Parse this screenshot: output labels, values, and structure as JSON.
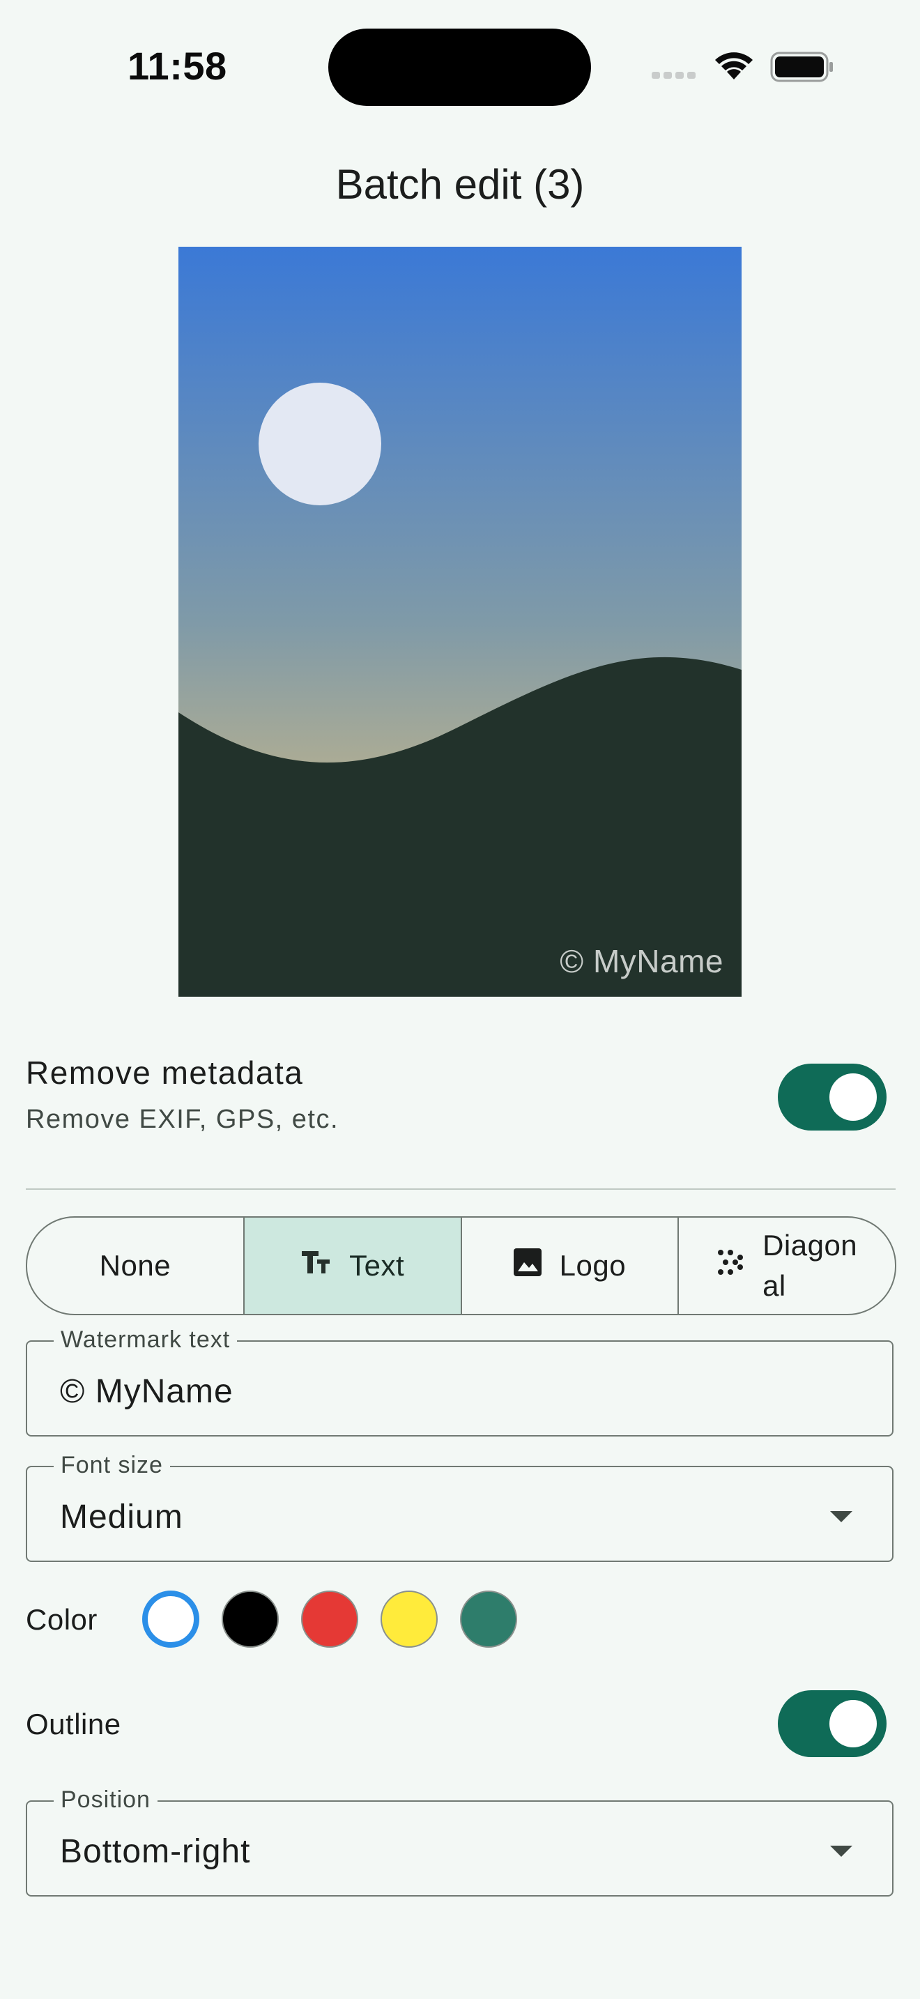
{
  "status": {
    "time": "11:58"
  },
  "header": {
    "title": "Batch edit (3)"
  },
  "preview": {
    "watermark_overlay": "© MyName"
  },
  "metadata": {
    "title": "Remove metadata",
    "subtitle": "Remove EXIF, GPS, etc.",
    "enabled": true
  },
  "watermark_type": {
    "options": [
      {
        "label": "None",
        "icon": ""
      },
      {
        "label": "Text",
        "icon": "text-fields-icon"
      },
      {
        "label": "Logo",
        "icon": "image-icon"
      },
      {
        "label": "Diagon\nal",
        "icon": "pattern-dots-icon"
      }
    ],
    "selected": "Text"
  },
  "watermark_text": {
    "label": "Watermark text",
    "value": "© MyName"
  },
  "font_size": {
    "label": "Font size",
    "value": "Medium"
  },
  "color": {
    "label": "Color",
    "swatches": [
      "#ffffff",
      "#000000",
      "#e53935",
      "#ffeb3b",
      "#2e7d6b"
    ],
    "selected_index": 0,
    "selected_ring": "#2b8fe8"
  },
  "outline": {
    "label": "Outline",
    "enabled": true
  },
  "position": {
    "label": "Position",
    "value": "Bottom-right"
  },
  "colors": {
    "accent": "#0f6b57",
    "selected_segment": "#cde8df",
    "background": "#f3f8f5"
  }
}
